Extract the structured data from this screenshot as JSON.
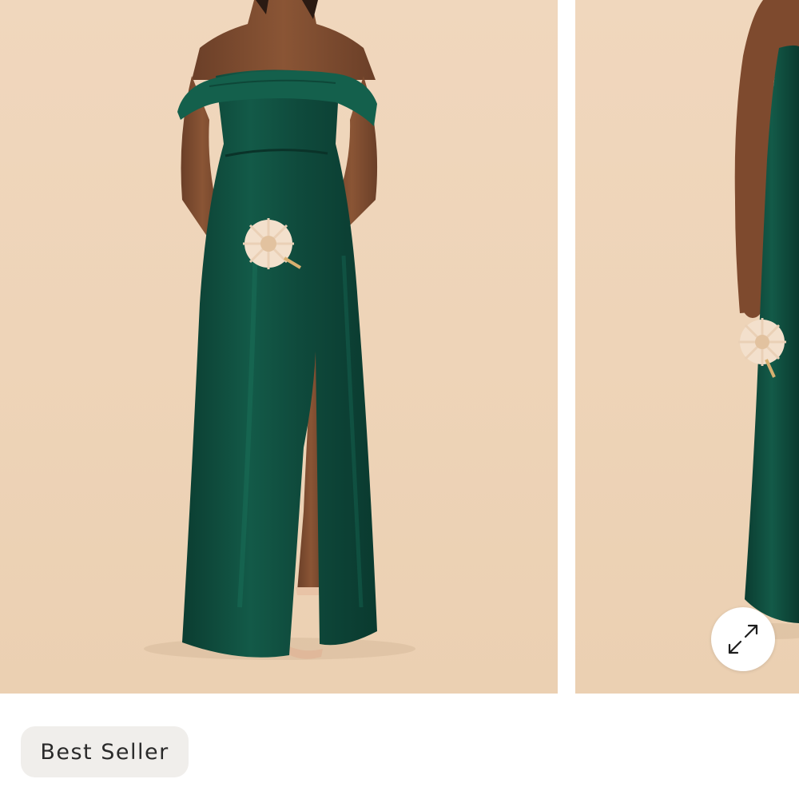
{
  "gallery": {
    "images": [
      {
        "name": "dress-front-view"
      },
      {
        "name": "dress-side-view"
      }
    ],
    "expand_icon": "expand-arrows-icon"
  },
  "product": {
    "badge_label": "Best Seller"
  },
  "colors": {
    "backdrop": "#eed4b8",
    "dress": "#0f4a3c",
    "badge_bg": "#f0eeeb",
    "badge_text": "#2a2a2a"
  }
}
